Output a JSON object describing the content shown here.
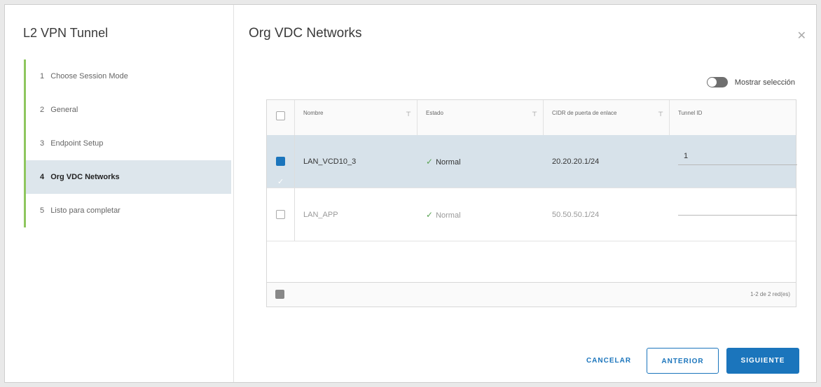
{
  "wizard": {
    "title": "L2 VPN Tunnel",
    "steps": [
      {
        "num": "1",
        "label": "Choose Session Mode"
      },
      {
        "num": "2",
        "label": "General"
      },
      {
        "num": "3",
        "label": "Endpoint Setup"
      },
      {
        "num": "4",
        "label": "Org VDC Networks"
      },
      {
        "num": "5",
        "label": "Listo para completar"
      }
    ],
    "active_step": 4
  },
  "main": {
    "title": "Org VDC Networks",
    "toggle_label": "Mostrar selección"
  },
  "grid": {
    "columns": [
      "Nombre",
      "Estado",
      "CIDR de puerta de enlace",
      "Tunnel ID"
    ],
    "rows": [
      {
        "name": "LAN_VCD10_3",
        "status": "Normal",
        "cidr": "20.20.20.1/24",
        "tunnel_id": "1",
        "selected": true
      },
      {
        "name": "LAN_APP",
        "status": "Normal",
        "cidr": "50.50.50.1/24",
        "tunnel_id": "",
        "selected": false
      }
    ],
    "footer_count": "1-2 de 2 red(es)"
  },
  "buttons": {
    "cancel": "CANCELAR",
    "previous": "ANTERIOR",
    "next": "SIGUIENTE"
  },
  "colors": {
    "accent": "#1b75bc",
    "step_bar": "#8ec65e",
    "selected_row": "#d7e2ea",
    "status_ok": "#5aa454"
  }
}
